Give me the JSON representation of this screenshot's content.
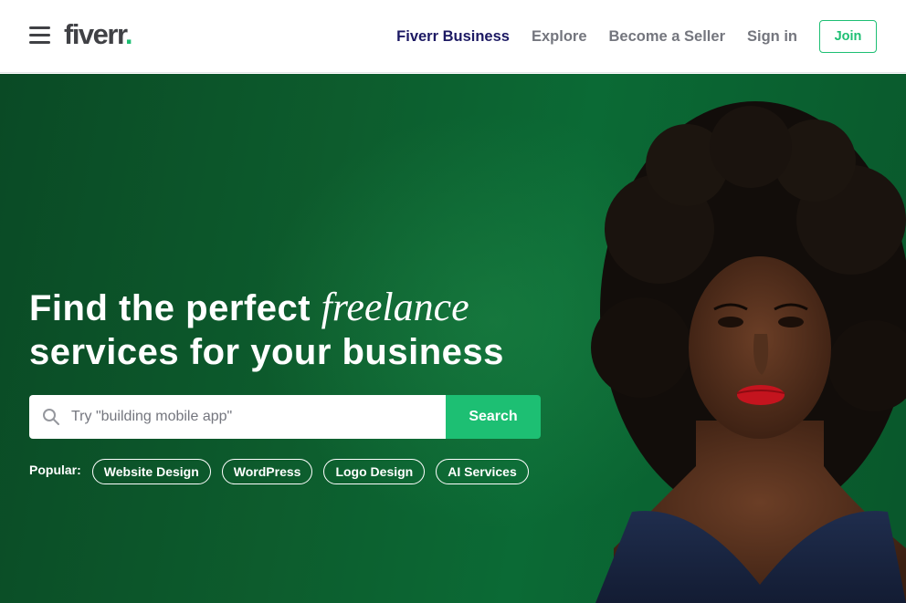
{
  "header": {
    "logo_text": "fiverr",
    "logo_dot": ".",
    "nav": {
      "business": "Fiverr Business",
      "explore": "Explore",
      "become_seller": "Become a Seller",
      "sign_in": "Sign in",
      "join": "Join"
    }
  },
  "hero": {
    "headline_part1": "Find the perfect ",
    "headline_emphasis": "freelance",
    "headline_part2": "services for your business",
    "search": {
      "placeholder": "Try \"building mobile app\"",
      "value": "",
      "button_label": "Search"
    },
    "popular": {
      "label": "Popular:",
      "items": [
        "Website Design",
        "WordPress",
        "Logo Design",
        "AI Services"
      ]
    }
  },
  "colors": {
    "brand_green": "#1dbf73",
    "business_navy": "#1c1963",
    "hero_bg": "#0d5c2d"
  },
  "icons": [
    "hamburger-menu-icon",
    "search-icon"
  ]
}
